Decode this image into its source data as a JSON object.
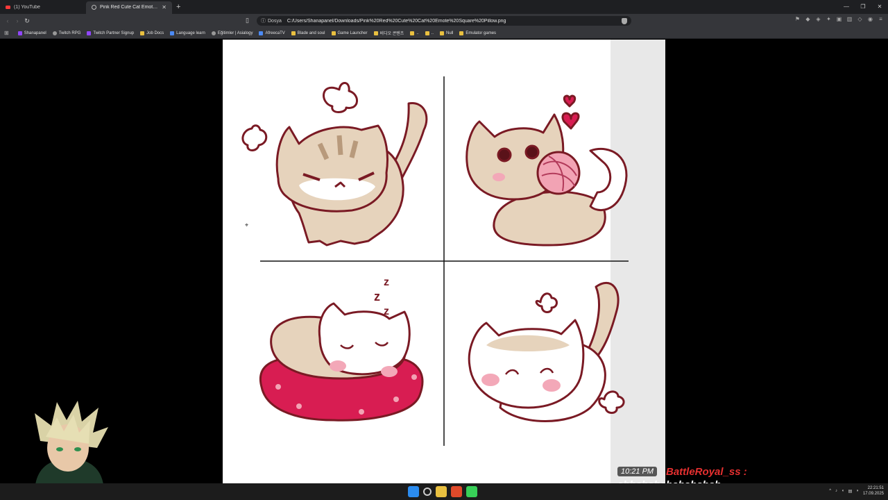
{
  "tabs": [
    {
      "title": "(1) YouTube",
      "active": false
    },
    {
      "title": "Pink Red Cute Cat Emote Square Pillow.png",
      "active": true
    }
  ],
  "address": {
    "scheme_label": "Dosya",
    "url": "C:/Users/Shanapanel/Downloads/Pink%20Red%20Cute%20Cat%20Emote%20Square%20Pillow.png"
  },
  "bookmarks": [
    {
      "label": "Shanapanel",
      "icon": "purple"
    },
    {
      "label": "Twitch RPG",
      "icon": "gray"
    },
    {
      "label": "Twitch Partner Signup",
      "icon": "purple"
    },
    {
      "label": "Job Docs",
      "icon": "folder"
    },
    {
      "label": "Language learn",
      "icon": "blue"
    },
    {
      "label": "Eğitimler | Asialogy",
      "icon": "gray"
    },
    {
      "label": "AfreecaTV",
      "icon": "blue"
    },
    {
      "label": "Blade and soul",
      "icon": "folder"
    },
    {
      "label": "Game Launcher",
      "icon": "folder"
    },
    {
      "label": "비디오 콘텐츠",
      "icon": "folder"
    },
    {
      "label": "..",
      "icon": "folder"
    },
    {
      "label": "..",
      "icon": "folder"
    },
    {
      "label": "Null",
      "icon": "folder"
    },
    {
      "label": "Emulator games",
      "icon": "folder"
    }
  ],
  "overlay": {
    "chat_time": "10:21 PM",
    "chat_user": "BattleRoyal_ss :",
    "chat_message": "ahhshahshahshshah"
  },
  "taskbar": {
    "time": "22:21:51",
    "date": "17.09.2025"
  },
  "colors": {
    "outline": "#7a1a24",
    "fur": "#e6d3bc",
    "stripe": "#b89a7c",
    "blush": "#f3a8b8",
    "pillow": "#d81d52",
    "yarn": "#f2a3b4"
  }
}
